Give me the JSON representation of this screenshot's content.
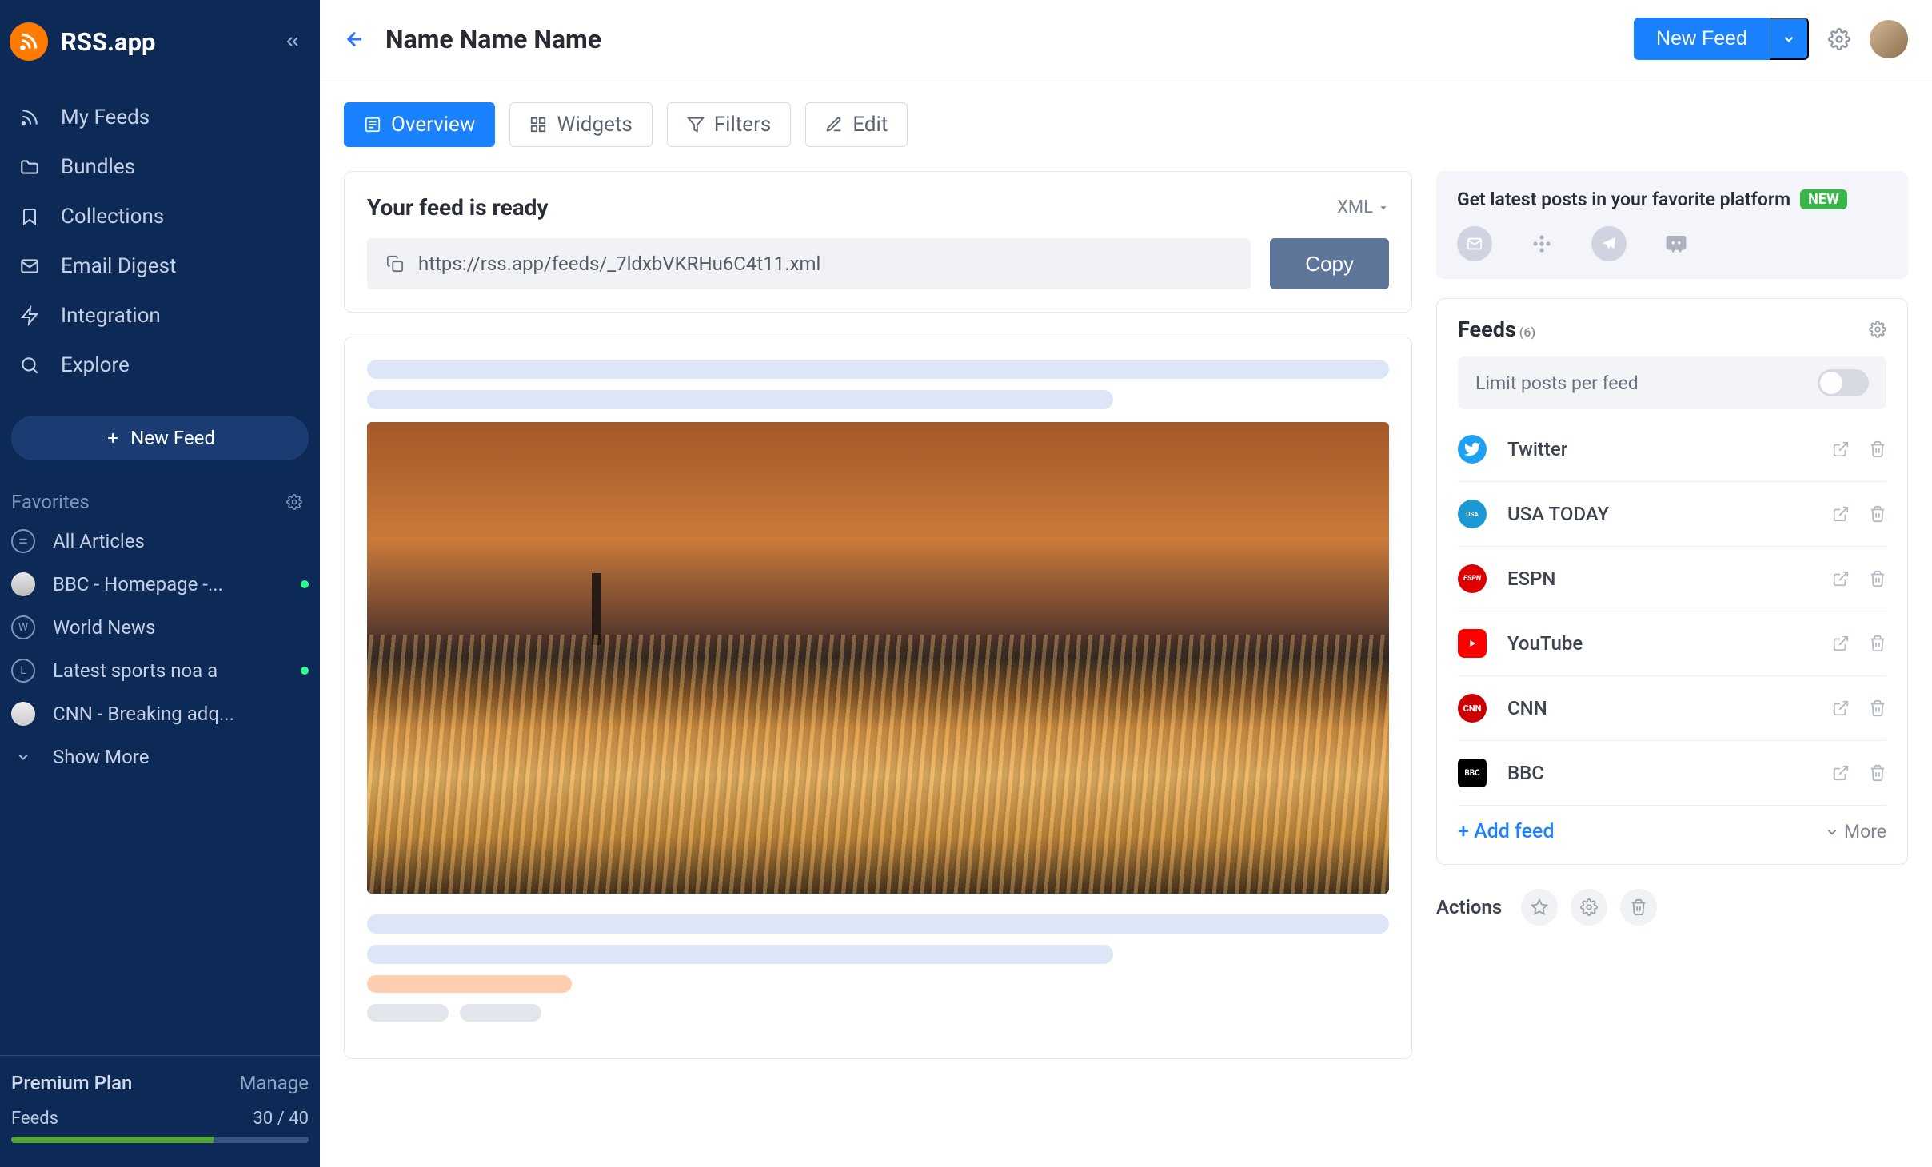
{
  "app": {
    "name": "RSS.app"
  },
  "sidebar": {
    "nav": [
      {
        "label": "My Feeds",
        "icon": "rss"
      },
      {
        "label": "Bundles",
        "icon": "folder"
      },
      {
        "label": "Collections",
        "icon": "bookmark"
      },
      {
        "label": "Email Digest",
        "icon": "mail"
      },
      {
        "label": "Integration",
        "icon": "zap"
      },
      {
        "label": "Explore",
        "icon": "search"
      }
    ],
    "new_feed_label": "New Feed",
    "favorites": {
      "title": "Favorites",
      "items": [
        {
          "label": "All Articles",
          "icon_type": "all"
        },
        {
          "label": "BBC - Homepage -...",
          "icon_type": "img",
          "dot": true
        },
        {
          "label": "World News",
          "icon_type": "letter",
          "letter": "W"
        },
        {
          "label": "Latest sports noa a",
          "icon_type": "letter",
          "letter": "L",
          "dot": true
        },
        {
          "label": "CNN - Breaking adq...",
          "icon_type": "img"
        }
      ],
      "show_more": "Show More"
    },
    "footer": {
      "plan": "Premium Plan",
      "manage": "Manage",
      "feeds_label": "Feeds",
      "feeds_count": "30 / 40"
    }
  },
  "header": {
    "title": "Name Name Name",
    "new_feed": "New Feed"
  },
  "tabs": [
    {
      "label": "Overview",
      "icon": "overview",
      "active": true
    },
    {
      "label": "Widgets",
      "icon": "widgets"
    },
    {
      "label": "Filters",
      "icon": "filter"
    },
    {
      "label": "Edit",
      "icon": "edit"
    }
  ],
  "feed_ready": {
    "title": "Your feed is ready",
    "format": "XML",
    "url": "https://rss.app/feeds/_7ldxbVKRHu6C4t11.xml",
    "copy": "Copy"
  },
  "platforms": {
    "title": "Get latest posts in your favorite platform",
    "badge": "NEW"
  },
  "feeds_panel": {
    "title": "Feeds",
    "count": "(6)",
    "limit_label": "Limit posts per feed",
    "items": [
      {
        "name": "Twitter",
        "color": "#1da1f2"
      },
      {
        "name": "USA TODAY",
        "color": "#1a99d5"
      },
      {
        "name": "ESPN",
        "color": "#d00"
      },
      {
        "name": "YouTube",
        "color": "#ff0000"
      },
      {
        "name": "CNN",
        "color": "#cc0000"
      },
      {
        "name": "BBC",
        "color": "#000"
      }
    ],
    "add": "+ Add feed",
    "more": "More"
  },
  "actions": {
    "label": "Actions"
  }
}
